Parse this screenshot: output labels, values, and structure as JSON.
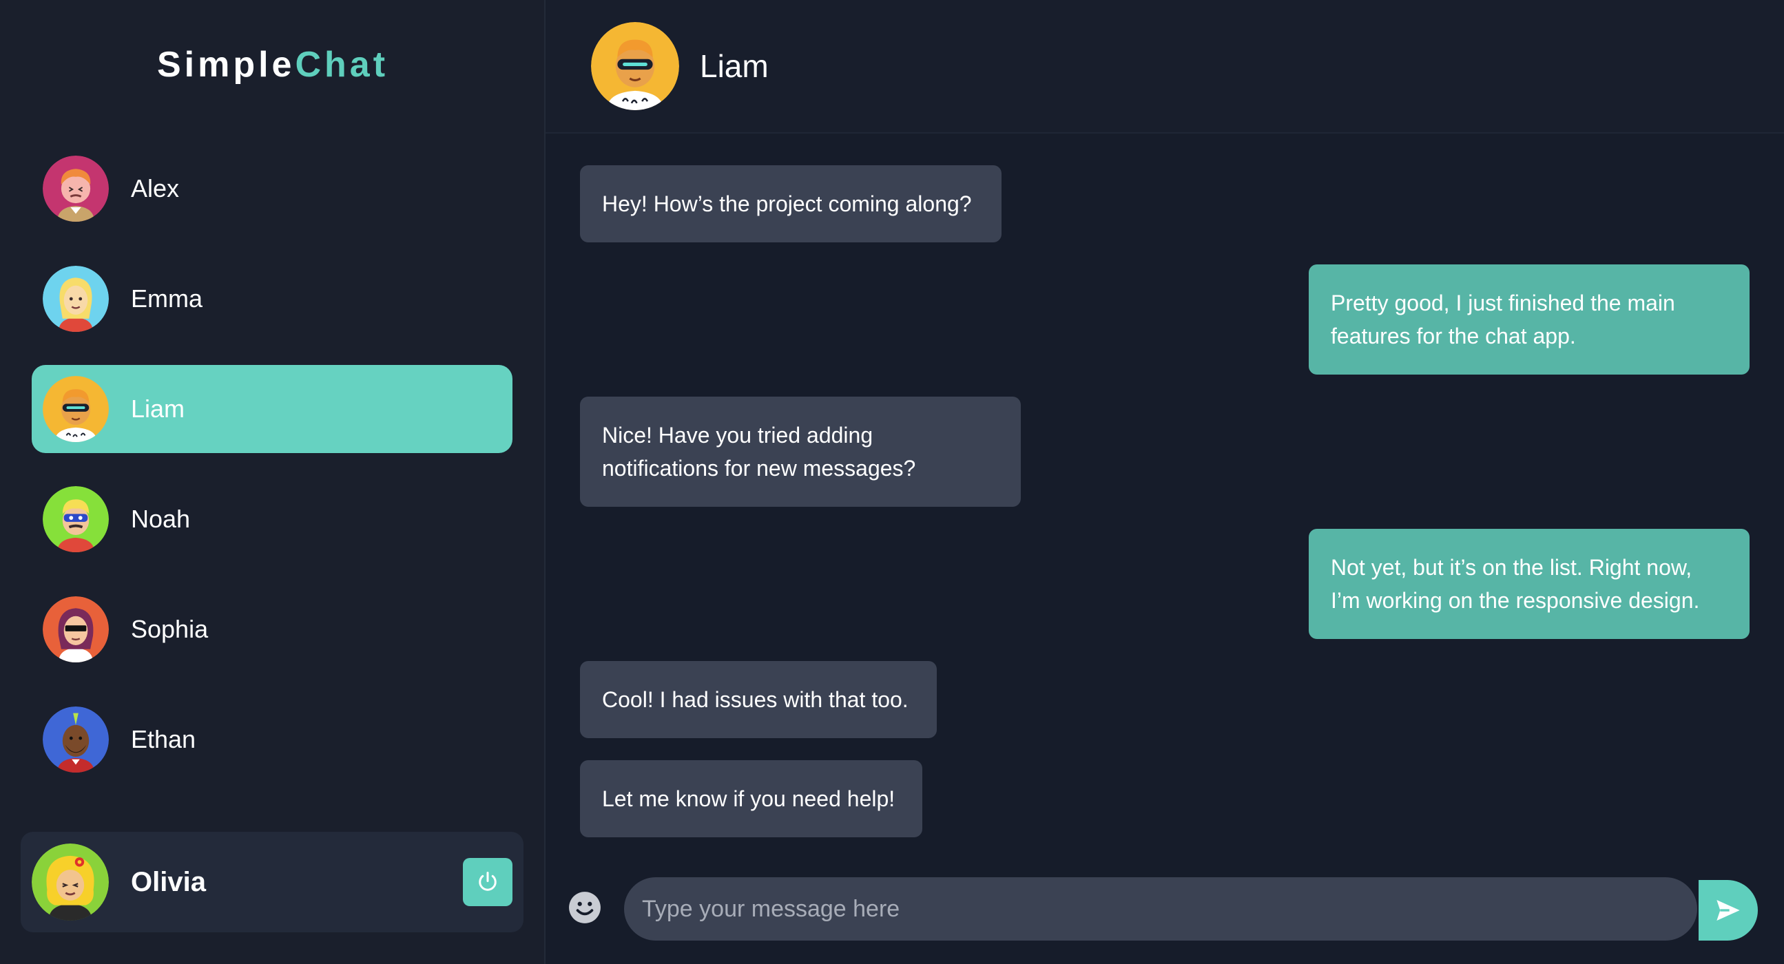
{
  "brand": {
    "part1": "Simple",
    "part2": "Chat"
  },
  "contacts": [
    {
      "name": "Alex",
      "avatar": "avatar-alex-icon"
    },
    {
      "name": "Emma",
      "avatar": "avatar-emma-icon"
    },
    {
      "name": "Liam",
      "avatar": "avatar-liam-icon",
      "active": true
    },
    {
      "name": "Noah",
      "avatar": "avatar-noah-icon"
    },
    {
      "name": "Sophia",
      "avatar": "avatar-sophia-icon"
    },
    {
      "name": "Ethan",
      "avatar": "avatar-ethan-icon"
    }
  ],
  "current_user": {
    "name": "Olivia",
    "logout_icon": "power-icon"
  },
  "chat": {
    "header_name": "Liam",
    "messages": [
      {
        "direction": "incoming",
        "text": "Hey! How’s the project coming along?"
      },
      {
        "direction": "outgoing",
        "lines": [
          "Pretty good, I just finished the main",
          "features for the chat app."
        ]
      },
      {
        "direction": "incoming",
        "lines": [
          "Nice! Have you tried adding",
          "notifications for new messages?"
        ]
      },
      {
        "direction": "outgoing",
        "lines": [
          "Not yet, but it’s on the list. Right now,",
          "I’m working on the responsive design."
        ]
      },
      {
        "direction": "incoming",
        "text": "Cool! I had issues with that too."
      },
      {
        "direction": "incoming",
        "text": "Let me know if you need help!"
      }
    ]
  },
  "composer": {
    "placeholder": "Type your message here",
    "emoji_icon": "smiley-icon",
    "send_icon": "send-arrow-icon"
  },
  "colors": {
    "accent": "#5fcfbd",
    "active_contact": "#66d2c1",
    "incoming_bubble": "#3b4253",
    "outgoing_bubble": "#57b5a6",
    "sidebar_bg": "#1a1f2c",
    "main_bg": "#161c2a"
  }
}
